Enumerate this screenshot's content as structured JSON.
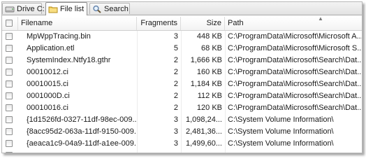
{
  "tabs": [
    {
      "label": "Drive C:",
      "icon": "drive-icon"
    },
    {
      "label": "File list",
      "icon": "folder-icon"
    },
    {
      "label": "Search",
      "icon": "search-icon"
    }
  ],
  "columns": {
    "filename": "Filename",
    "fragments": "Fragments",
    "size": "Size",
    "path": "Path"
  },
  "rows": [
    {
      "filename": "MpWppTracing.bin",
      "fragments": "3",
      "size": "448 KB",
      "path": "C:\\ProgramData\\Microsoft\\Microsoft A..."
    },
    {
      "filename": "Application.etl",
      "fragments": "5",
      "size": "68 KB",
      "path": "C:\\ProgramData\\Microsoft\\Microsoft S..."
    },
    {
      "filename": "SystemIndex.Ntfy18.gthr",
      "fragments": "2",
      "size": "1,666 KB",
      "path": "C:\\ProgramData\\Microsoft\\Search\\Dat..."
    },
    {
      "filename": "00010012.ci",
      "fragments": "2",
      "size": "160 KB",
      "path": "C:\\ProgramData\\Microsoft\\Search\\Dat..."
    },
    {
      "filename": "00010015.ci",
      "fragments": "2",
      "size": "1,184 KB",
      "path": "C:\\ProgramData\\Microsoft\\Search\\Dat..."
    },
    {
      "filename": "0001000D.ci",
      "fragments": "2",
      "size": "112 KB",
      "path": "C:\\ProgramData\\Microsoft\\Search\\Dat..."
    },
    {
      "filename": "00010016.ci",
      "fragments": "2",
      "size": "120 KB",
      "path": "C:\\ProgramData\\Microsoft\\Search\\Dat..."
    },
    {
      "filename": "{1d1526fd-0327-11df-98ec-009...",
      "fragments": "3",
      "size": "1,098,24...",
      "path": "C:\\System Volume Information\\"
    },
    {
      "filename": "{8acc95d2-063a-11df-9150-009...",
      "fragments": "3",
      "size": "2,481,36...",
      "path": "C:\\System Volume Information\\"
    },
    {
      "filename": "{aeaca1c9-04a9-11df-a1ee-009...",
      "fragments": "3",
      "size": "1,499,60...",
      "path": "C:\\System Volume Information\\"
    }
  ]
}
